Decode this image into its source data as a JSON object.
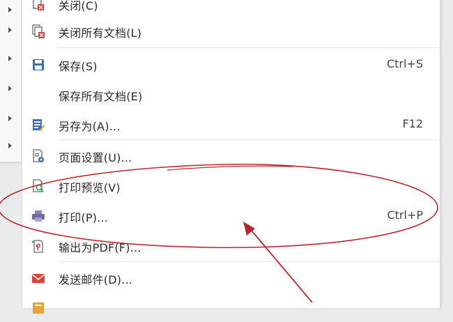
{
  "submenu_arrow_count": 6,
  "menu": {
    "items": [
      {
        "label": "关闭(C)",
        "shortcut": "",
        "icon": "close-doc-icon"
      },
      {
        "label": "关闭所有文档(L)",
        "shortcut": "",
        "icon": "close-all-docs-icon"
      },
      {
        "label": "保存(S)",
        "shortcut": "Ctrl+S",
        "icon": "save-icon"
      },
      {
        "label": "保存所有文档(E)",
        "shortcut": "",
        "icon": ""
      },
      {
        "label": "另存为(A)...",
        "shortcut": "F12",
        "icon": "save-as-icon"
      },
      {
        "label": "页面设置(U)...",
        "shortcut": "",
        "icon": "page-setup-icon"
      },
      {
        "label": "打印预览(V)",
        "shortcut": "",
        "icon": "print-preview-icon"
      },
      {
        "label": "打印(P)...",
        "shortcut": "Ctrl+P",
        "icon": "printer-icon"
      },
      {
        "label": "输出为PDF(F)...",
        "shortcut": "",
        "icon": "export-pdf-icon"
      },
      {
        "label": "发送邮件(D)...",
        "shortcut": "",
        "icon": "mail-icon"
      },
      {
        "label": "",
        "shortcut": "",
        "icon": "doc-icon"
      }
    ]
  },
  "annotation": {
    "color": "#b7282e",
    "shape": "ellipse around print preview and print items, arrow pointing up-left to the ellipse"
  },
  "colors": {
    "accent_blue": "#3d6fb8",
    "icon_red": "#d9453d",
    "menu_bg": "#ffffff"
  }
}
